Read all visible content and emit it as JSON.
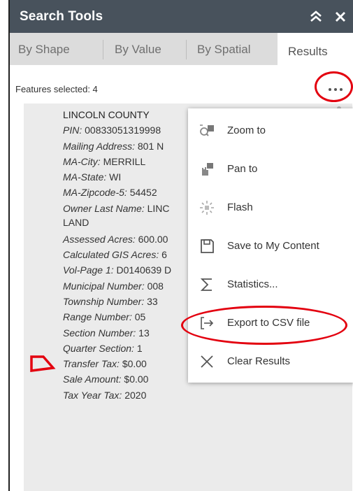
{
  "panel": {
    "title": "Search Tools",
    "collapse_icon": "double-chevron-up-icon",
    "close_icon": "close-icon"
  },
  "tabs": [
    {
      "label": "By Shape",
      "active": false
    },
    {
      "label": "By Value",
      "active": false
    },
    {
      "label": "By Spatial",
      "active": false
    },
    {
      "label": "Results",
      "active": true
    }
  ],
  "results": {
    "features_selected": "Features selected: 4",
    "more_icon": "more-ellipsis-icon",
    "feature_icon": "polygon-icon",
    "record": {
      "county": "LINCOLN COUNTY",
      "fields": [
        {
          "k": "PIN:",
          "v": "00833051319998"
        },
        {
          "k": "Mailing Address:",
          "v": "801 N"
        },
        {
          "k": "MA-City:",
          "v": "MERRILL"
        },
        {
          "k": "MA-State:",
          "v": "WI"
        },
        {
          "k": "MA-Zipcode-5:",
          "v": "54452"
        },
        {
          "k": "Owner Last Name:",
          "v": "LINC LAND"
        },
        {
          "k": "Assessed Acres:",
          "v": "600.00"
        },
        {
          "k": "Calculated GIS Acres:",
          "v": "6"
        },
        {
          "k": "Vol-Page 1:",
          "v": "D0140639 D"
        },
        {
          "k": "Municipal Number:",
          "v": "008"
        },
        {
          "k": "Township Number:",
          "v": "33"
        },
        {
          "k": "Range Number:",
          "v": "05"
        },
        {
          "k": "Section Number:",
          "v": "13"
        },
        {
          "k": "Quarter Section:",
          "v": "1"
        },
        {
          "k": "Transfer Tax:",
          "v": "$0.00"
        },
        {
          "k": "Sale Amount:",
          "v": "$0.00"
        },
        {
          "k": "Tax Year Tax:",
          "v": "2020"
        }
      ]
    }
  },
  "menu": {
    "items": [
      {
        "label": "Zoom to",
        "icon": "zoom-to-icon"
      },
      {
        "label": "Pan to",
        "icon": "pan-to-icon"
      },
      {
        "label": "Flash",
        "icon": "flash-icon"
      },
      {
        "label": "Save to My Content",
        "icon": "save-icon"
      },
      {
        "label": "Statistics...",
        "icon": "sigma-icon"
      },
      {
        "label": "Export to CSV file",
        "icon": "export-icon"
      },
      {
        "label": "Clear Results",
        "icon": "clear-x-icon"
      }
    ]
  },
  "colors": {
    "titlebar": "#48525c",
    "tabs_bg": "#dcdcdc",
    "results_bg": "#ebebeb",
    "highlight_ring": "#e3000f",
    "feature_polygon": "#e3000f"
  }
}
